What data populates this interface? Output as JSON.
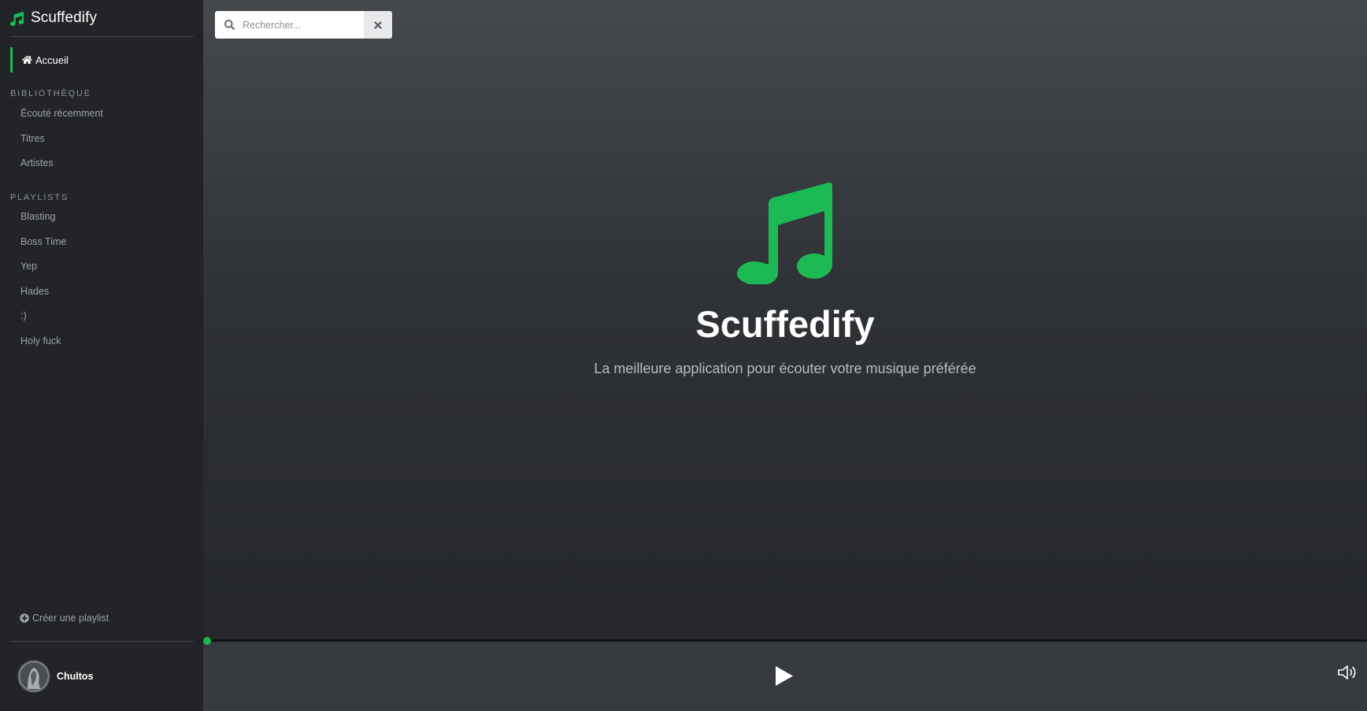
{
  "app": {
    "name": "Scuffedify",
    "accent_color": "#1db954",
    "brand_icon": "music-note-icon"
  },
  "sidebar": {
    "home": {
      "label": "Accueil",
      "icon": "home-icon",
      "active": true
    },
    "library": {
      "title": "BIBLIOTHÈQUE",
      "items": [
        {
          "label": "Écouté récemment"
        },
        {
          "label": "Titres"
        },
        {
          "label": "Artistes"
        }
      ]
    },
    "playlists": {
      "title": "PLAYLISTS",
      "items": [
        {
          "label": "Blasting"
        },
        {
          "label": "Boss Time"
        },
        {
          "label": "Yep"
        },
        {
          "label": "Hades"
        },
        {
          "label": ":)"
        },
        {
          "label": "Holy fuck"
        }
      ]
    },
    "create_playlist": {
      "label": "Créer une playlist",
      "icon": "plus-circle-icon"
    },
    "user": {
      "name": "Chultos",
      "avatar": "avatar"
    }
  },
  "search": {
    "placeholder": "Rechercher...",
    "value": "",
    "icon": "search-icon",
    "clear_icon": "close-icon"
  },
  "hero": {
    "title": "Scuffedify",
    "subtitle": "La meilleure application pour écouter votre musique préférée",
    "icon": "music-note-icon"
  },
  "player": {
    "progress": 0,
    "play_icon": "play-icon",
    "volume_icon": "volume-icon"
  }
}
